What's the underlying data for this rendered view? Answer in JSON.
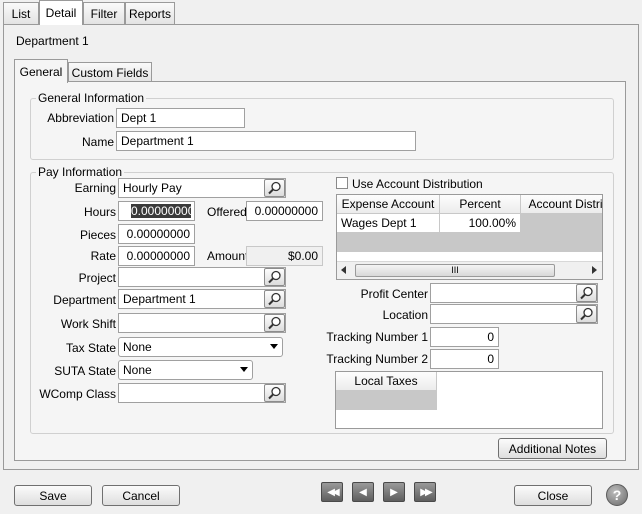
{
  "top_tabs": [
    "List",
    "Detail",
    "Filter",
    "Reports"
  ],
  "record_title": "Department 1",
  "inner_tabs": [
    "General",
    "Custom Fields"
  ],
  "general_info": {
    "title": "General Information",
    "abbreviation_label": "Abbreviation",
    "abbreviation_value": "Dept 1",
    "name_label": "Name",
    "name_value": "Department 1"
  },
  "pay_info": {
    "title": "Pay Information",
    "earning_label": "Earning",
    "earning_value": "Hourly Pay",
    "hours_label": "Hours",
    "hours_value": "0.00000000",
    "offered_label": "Offered",
    "offered_value": "0.00000000",
    "pieces_label": "Pieces",
    "pieces_value": "0.00000000",
    "rate_label": "Rate",
    "rate_value": "0.00000000",
    "amount_label": "Amount",
    "amount_value": "$0.00",
    "project_label": "Project",
    "project_value": "",
    "department_label": "Department",
    "department_value": "Department 1",
    "work_shift_label": "Work Shift",
    "work_shift_value": "",
    "tax_state_label": "Tax State",
    "tax_state_value": "None",
    "suta_state_label": "SUTA State",
    "suta_state_value": "None",
    "wcomp_label": "WComp Class",
    "wcomp_value": ""
  },
  "distribution": {
    "checkbox_label": "Use Account Distribution",
    "checked": false,
    "columns": [
      "Expense Account",
      "Percent",
      "Account Distri"
    ],
    "rows": [
      [
        "Wages Dept 1",
        "100.00%",
        ""
      ]
    ],
    "scroll_grip": "III"
  },
  "right_fields": {
    "profit_center_label": "Profit Center",
    "profit_center_value": "",
    "location_label": "Location",
    "location_value": "",
    "tracking1_label": "Tracking Number 1",
    "tracking1_value": "0",
    "tracking2_label": "Tracking Number 2",
    "tracking2_value": "0"
  },
  "local_taxes": {
    "column": "Local Taxes"
  },
  "buttons": {
    "additional_notes": "Additional Notes",
    "save": "Save",
    "cancel": "Cancel",
    "close": "Close",
    "help": "?"
  },
  "nav": {
    "first": "◀◀",
    "prev": "◀",
    "next": "▶",
    "last": "▶▶"
  }
}
